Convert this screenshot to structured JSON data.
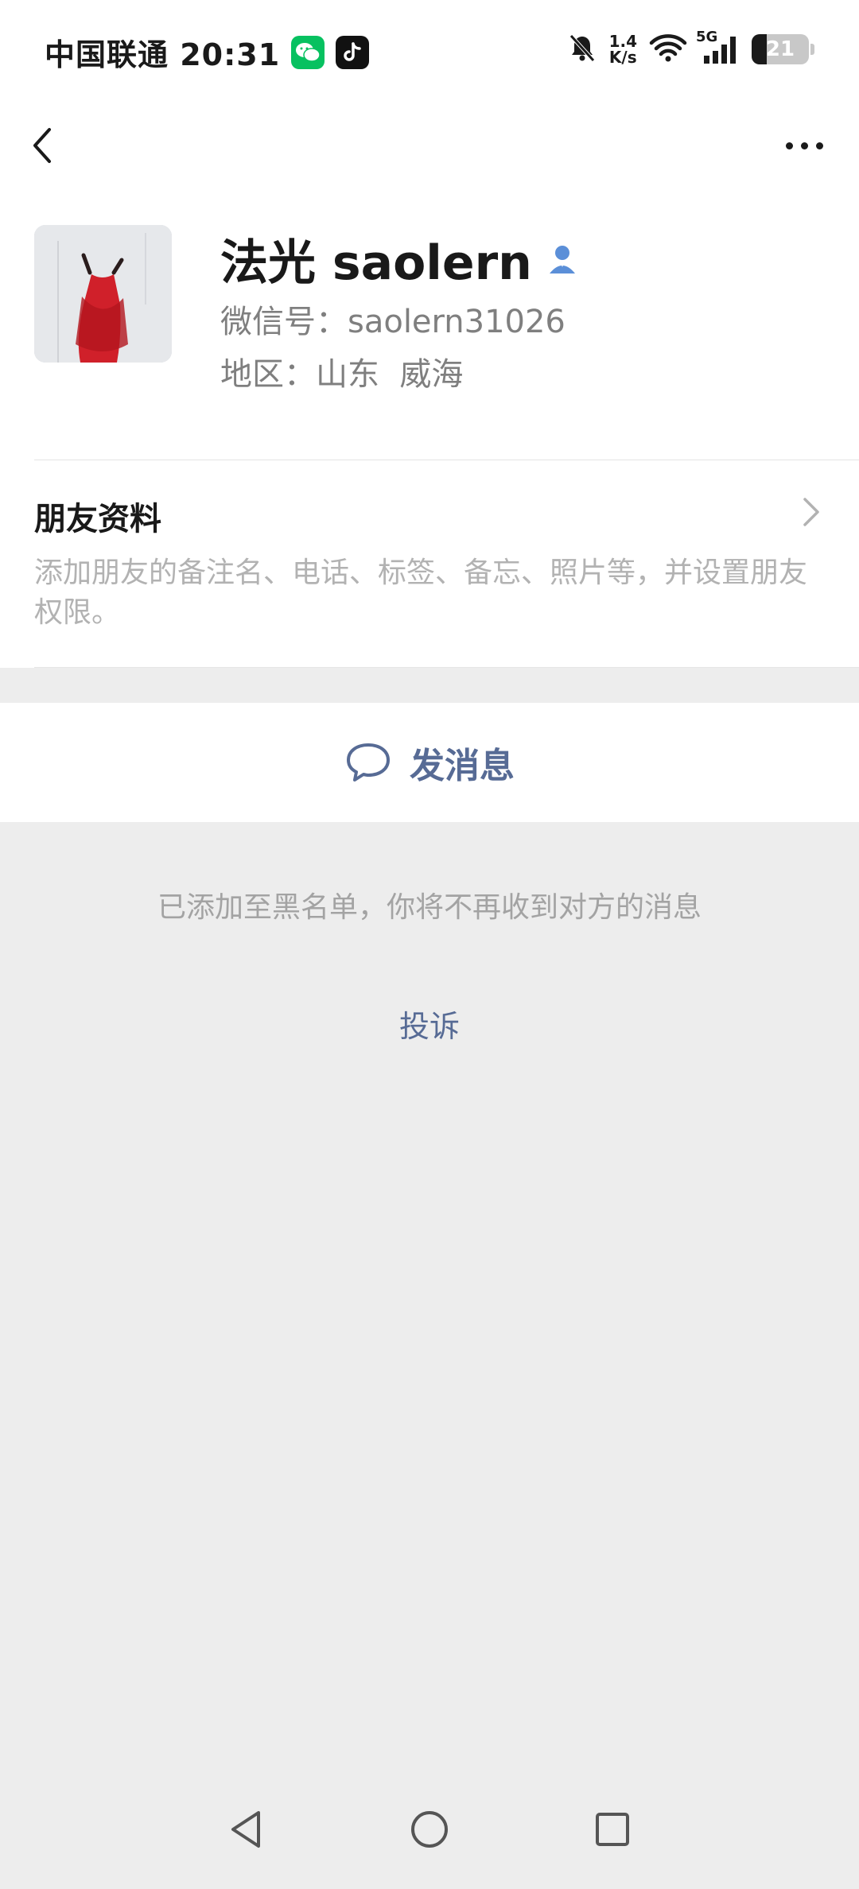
{
  "status_bar": {
    "carrier_time": "中国联通 20:31",
    "net_speed_value": "1.4",
    "net_speed_unit": "K/s",
    "network_type": "5G",
    "battery_level": "21",
    "notification_apps": [
      "wechat-icon",
      "tiktok-icon"
    ],
    "status_icons": [
      "bell-muted-icon",
      "wifi-icon",
      "signal-icon",
      "battery-icon"
    ]
  },
  "nav": {
    "back_icon": "chevron-left-icon",
    "more_icon": "more-dots-icon"
  },
  "profile": {
    "name": "法光 saolern",
    "wechat_id": "微信号：saolern31026",
    "region": "地区：山东  威海"
  },
  "friend_info": {
    "title": "朋友资料",
    "description": "添加朋友的备注名、电话、标签、备忘、照片等，并设置朋友权限。"
  },
  "actions": {
    "send_message": "发消息"
  },
  "notice": {
    "blacklist": "已添加至黑名单，你将不再收到对方的消息",
    "complain": "投诉"
  },
  "colors": {
    "link_blue": "#576b95",
    "background": "#ededed",
    "wechat_green": "#07c160"
  }
}
